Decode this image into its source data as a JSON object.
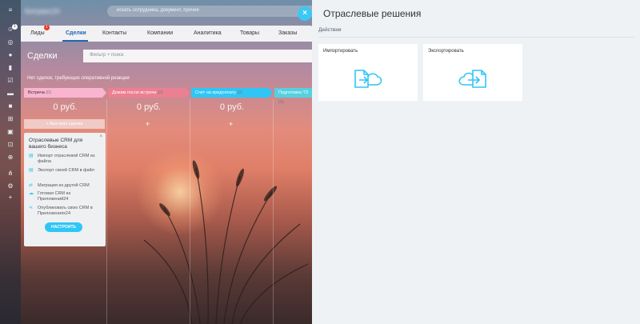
{
  "header": {
    "logo_text": "Битрикс24",
    "logo_num": "24",
    "search_placeholder": "искать сотрудника, документ, прочее"
  },
  "left_rail": {
    "badge": "1",
    "icons": [
      "menu-icon",
      "bell-icon",
      "target-icon",
      "chat-icon",
      "chart-icon",
      "task-icon",
      "mail-icon",
      "briefcase-icon",
      "cart-icon",
      "calendar-icon",
      "grid-icon",
      "plus-circle-icon",
      "gear-icon",
      "add-icon"
    ]
  },
  "tabs": [
    {
      "label": "Лиды",
      "badge": "1"
    },
    {
      "label": "Сделки"
    },
    {
      "label": "Контакты"
    },
    {
      "label": "Компании"
    },
    {
      "label": "Аналитика"
    },
    {
      "label": "Товары"
    },
    {
      "label": "Заказы"
    }
  ],
  "crm": {
    "title": "Сделки",
    "filter_placeholder": "Фильтр + поиск",
    "no_deals_text": "Нет сделок, требующих оперативной реакции",
    "stages": [
      {
        "label": "Встреча",
        "count": "(0)",
        "sum": "0 руб."
      },
      {
        "label": "Дожим после встречи",
        "count": "(0)",
        "sum": "0 руб."
      },
      {
        "label": "Счет на предоплату",
        "count": "(0)",
        "sum": "0 руб."
      },
      {
        "label": "Подготовка ТЗ",
        "count": "(0)"
      }
    ],
    "quick_deal": "+ Быстрая сделка",
    "plus": "+"
  },
  "widget": {
    "close": "×",
    "title": "Отраслевые CRM для вашего бизнеса",
    "items": [
      "Импорт отраслевой CRM из файла",
      "Экспорт своей CRM в файл",
      "Миграция из другой CRM",
      "Готовая CRM из Приложений24",
      "Опубликовать свою CRM в Приложениях24"
    ],
    "button": "НАСТРОИТЬ"
  },
  "panel": {
    "title": "Отраслевые решения",
    "actions_label": "Действия",
    "tiles": [
      {
        "label": "Импортировать"
      },
      {
        "label": "Экспортировать"
      }
    ]
  },
  "colors": {
    "accent": "#2fc6f6",
    "close_button": "#3bc8f5",
    "stage_meeting": "#f9b5cf",
    "stage_followup": "#ec8093",
    "stage_invoice": "#2fc6f6"
  }
}
